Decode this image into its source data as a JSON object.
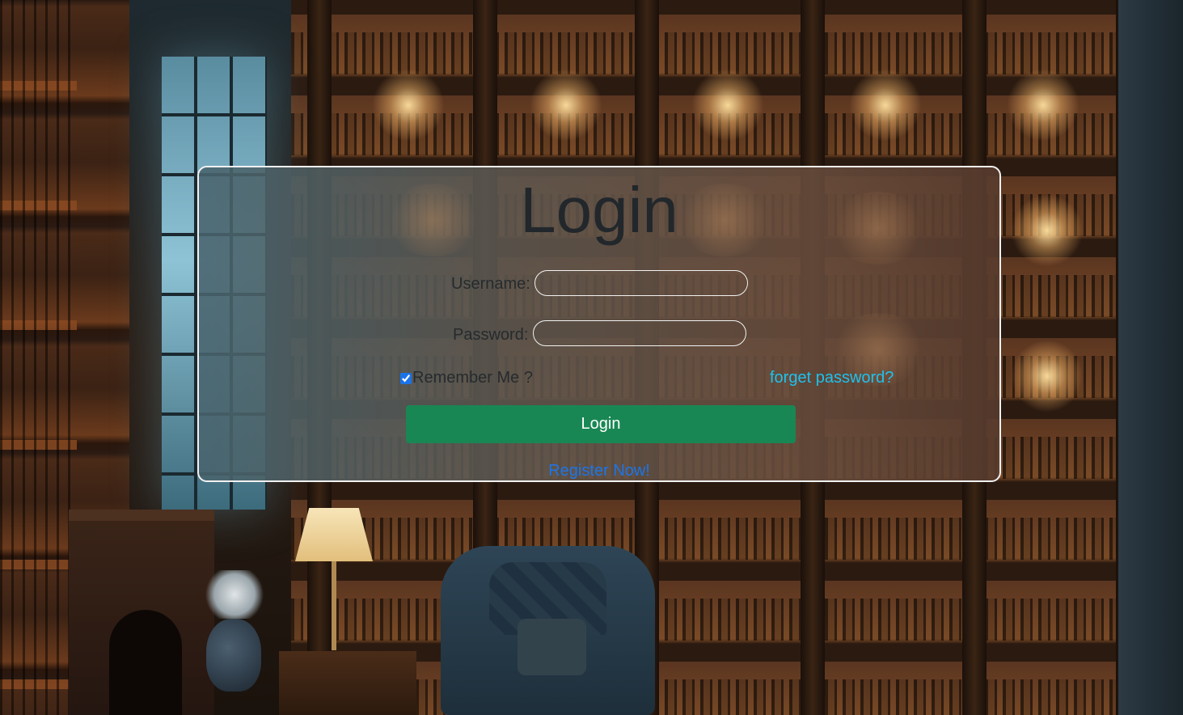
{
  "login": {
    "title": "Login",
    "username_label": "Username:",
    "username_value": "",
    "password_label": "Password:",
    "password_value": "",
    "remember_label": "Remember Me ?",
    "remember_checked": true,
    "forget_link": "forget password?",
    "submit_label": "Login",
    "register_link": "Register Now!"
  },
  "colors": {
    "button_bg": "#198754",
    "forget_link": "#1ec1ee",
    "register_link": "#1c75e8",
    "panel_border": "#f1f1f1"
  }
}
